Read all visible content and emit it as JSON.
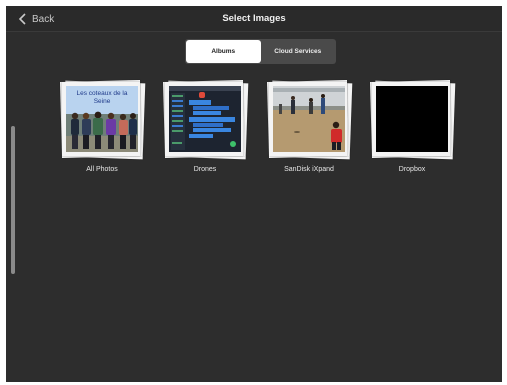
{
  "nav": {
    "back_label": "Back",
    "title": "Select Images"
  },
  "segments": {
    "albums": "Albums",
    "cloud": "Cloud Services"
  },
  "albums": [
    {
      "label": "All Photos",
      "caption": "Les coteaux de la Seine"
    },
    {
      "label": "Drones"
    },
    {
      "label": "SanDisk iXpand"
    },
    {
      "label": "Dropbox"
    }
  ],
  "colors": {
    "background": "#2d2d2d",
    "navbar": "#2a2a2a",
    "segment_active": "#ffffff"
  }
}
